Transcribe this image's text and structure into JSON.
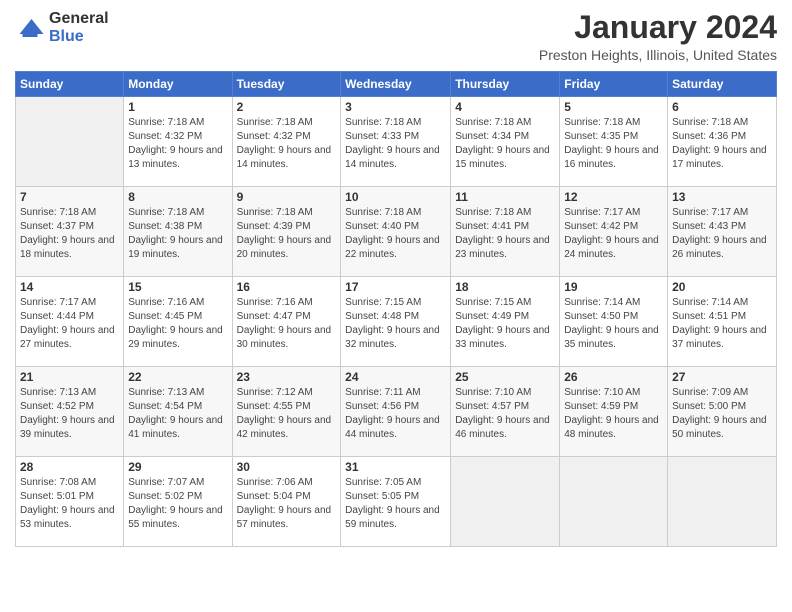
{
  "logo": {
    "line1": "General",
    "line2": "Blue"
  },
  "title": "January 2024",
  "subtitle": "Preston Heights, Illinois, United States",
  "days_of_week": [
    "Sunday",
    "Monday",
    "Tuesday",
    "Wednesday",
    "Thursday",
    "Friday",
    "Saturday"
  ],
  "weeks": [
    [
      {
        "num": "",
        "empty": true
      },
      {
        "num": "1",
        "sunrise": "7:18 AM",
        "sunset": "4:32 PM",
        "daylight": "9 hours and 13 minutes."
      },
      {
        "num": "2",
        "sunrise": "7:18 AM",
        "sunset": "4:32 PM",
        "daylight": "9 hours and 14 minutes."
      },
      {
        "num": "3",
        "sunrise": "7:18 AM",
        "sunset": "4:33 PM",
        "daylight": "9 hours and 14 minutes."
      },
      {
        "num": "4",
        "sunrise": "7:18 AM",
        "sunset": "4:34 PM",
        "daylight": "9 hours and 15 minutes."
      },
      {
        "num": "5",
        "sunrise": "7:18 AM",
        "sunset": "4:35 PM",
        "daylight": "9 hours and 16 minutes."
      },
      {
        "num": "6",
        "sunrise": "7:18 AM",
        "sunset": "4:36 PM",
        "daylight": "9 hours and 17 minutes."
      }
    ],
    [
      {
        "num": "7",
        "sunrise": "7:18 AM",
        "sunset": "4:37 PM",
        "daylight": "9 hours and 18 minutes."
      },
      {
        "num": "8",
        "sunrise": "7:18 AM",
        "sunset": "4:38 PM",
        "daylight": "9 hours and 19 minutes."
      },
      {
        "num": "9",
        "sunrise": "7:18 AM",
        "sunset": "4:39 PM",
        "daylight": "9 hours and 20 minutes."
      },
      {
        "num": "10",
        "sunrise": "7:18 AM",
        "sunset": "4:40 PM",
        "daylight": "9 hours and 22 minutes."
      },
      {
        "num": "11",
        "sunrise": "7:18 AM",
        "sunset": "4:41 PM",
        "daylight": "9 hours and 23 minutes."
      },
      {
        "num": "12",
        "sunrise": "7:17 AM",
        "sunset": "4:42 PM",
        "daylight": "9 hours and 24 minutes."
      },
      {
        "num": "13",
        "sunrise": "7:17 AM",
        "sunset": "4:43 PM",
        "daylight": "9 hours and 26 minutes."
      }
    ],
    [
      {
        "num": "14",
        "sunrise": "7:17 AM",
        "sunset": "4:44 PM",
        "daylight": "9 hours and 27 minutes."
      },
      {
        "num": "15",
        "sunrise": "7:16 AM",
        "sunset": "4:45 PM",
        "daylight": "9 hours and 29 minutes."
      },
      {
        "num": "16",
        "sunrise": "7:16 AM",
        "sunset": "4:47 PM",
        "daylight": "9 hours and 30 minutes."
      },
      {
        "num": "17",
        "sunrise": "7:15 AM",
        "sunset": "4:48 PM",
        "daylight": "9 hours and 32 minutes."
      },
      {
        "num": "18",
        "sunrise": "7:15 AM",
        "sunset": "4:49 PM",
        "daylight": "9 hours and 33 minutes."
      },
      {
        "num": "19",
        "sunrise": "7:14 AM",
        "sunset": "4:50 PM",
        "daylight": "9 hours and 35 minutes."
      },
      {
        "num": "20",
        "sunrise": "7:14 AM",
        "sunset": "4:51 PM",
        "daylight": "9 hours and 37 minutes."
      }
    ],
    [
      {
        "num": "21",
        "sunrise": "7:13 AM",
        "sunset": "4:52 PM",
        "daylight": "9 hours and 39 minutes."
      },
      {
        "num": "22",
        "sunrise": "7:13 AM",
        "sunset": "4:54 PM",
        "daylight": "9 hours and 41 minutes."
      },
      {
        "num": "23",
        "sunrise": "7:12 AM",
        "sunset": "4:55 PM",
        "daylight": "9 hours and 42 minutes."
      },
      {
        "num": "24",
        "sunrise": "7:11 AM",
        "sunset": "4:56 PM",
        "daylight": "9 hours and 44 minutes."
      },
      {
        "num": "25",
        "sunrise": "7:10 AM",
        "sunset": "4:57 PM",
        "daylight": "9 hours and 46 minutes."
      },
      {
        "num": "26",
        "sunrise": "7:10 AM",
        "sunset": "4:59 PM",
        "daylight": "9 hours and 48 minutes."
      },
      {
        "num": "27",
        "sunrise": "7:09 AM",
        "sunset": "5:00 PM",
        "daylight": "9 hours and 50 minutes."
      }
    ],
    [
      {
        "num": "28",
        "sunrise": "7:08 AM",
        "sunset": "5:01 PM",
        "daylight": "9 hours and 53 minutes."
      },
      {
        "num": "29",
        "sunrise": "7:07 AM",
        "sunset": "5:02 PM",
        "daylight": "9 hours and 55 minutes."
      },
      {
        "num": "30",
        "sunrise": "7:06 AM",
        "sunset": "5:04 PM",
        "daylight": "9 hours and 57 minutes."
      },
      {
        "num": "31",
        "sunrise": "7:05 AM",
        "sunset": "5:05 PM",
        "daylight": "9 hours and 59 minutes."
      },
      {
        "num": "",
        "empty": true
      },
      {
        "num": "",
        "empty": true
      },
      {
        "num": "",
        "empty": true
      }
    ]
  ]
}
